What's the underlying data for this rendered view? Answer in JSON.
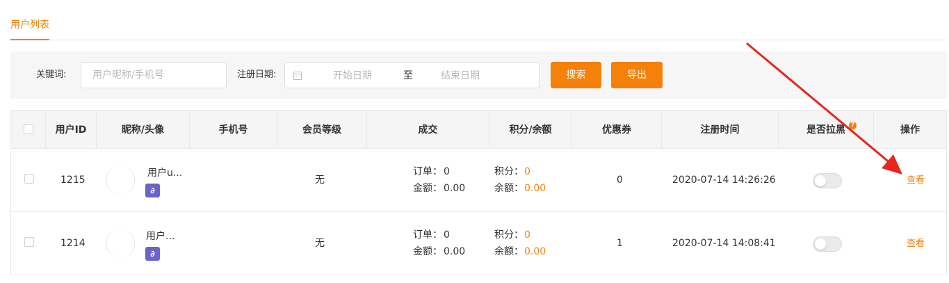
{
  "tabs": {
    "active": "用户列表"
  },
  "filter": {
    "keyword_label": "关键词:",
    "keyword_placeholder": "用户昵称/手机号",
    "date_label": "注册日期:",
    "date_start_placeholder": "开始日期",
    "date_separator": "至",
    "date_end_placeholder": "结束日期",
    "search_button": "搜索",
    "export_button": "导出"
  },
  "table": {
    "columns": [
      "用户ID",
      "昵称/头像",
      "手机号",
      "会员等级",
      "成交",
      "积分/余额",
      "优惠券",
      "注册时间",
      "是否拉黑",
      "操作"
    ],
    "help_icon": "?",
    "rows": [
      {
        "id": "1215",
        "nickname": "用户u...",
        "phone": "",
        "level": "无",
        "order_label": "订单：",
        "order_count": "0",
        "amount_label": "金额：",
        "amount": "0.00",
        "points_label": "积分：",
        "points": "0",
        "balance_label": "余额：",
        "balance": "0.00",
        "coupons": "0",
        "register_time": "2020-07-14 14:26:26",
        "blacklisted": false,
        "action": "查看"
      },
      {
        "id": "1214",
        "nickname": "用户...",
        "phone": "",
        "level": "无",
        "order_label": "订单：",
        "order_count": "0",
        "amount_label": "金额：",
        "amount": "0.00",
        "points_label": "积分：",
        "points": "0",
        "balance_label": "余额：",
        "balance": "0.00",
        "coupons": "1",
        "register_time": "2020-07-14 14:08:41",
        "blacklisted": false,
        "action": "查看"
      }
    ]
  },
  "colors": {
    "accent": "#f5800a",
    "annotation_arrow": "#e8261c",
    "mini_program_badge": "#6b63c9"
  },
  "icons": {
    "calendar": "calendar-icon",
    "mini_program": "mini-program-icon",
    "help": "help-icon"
  }
}
